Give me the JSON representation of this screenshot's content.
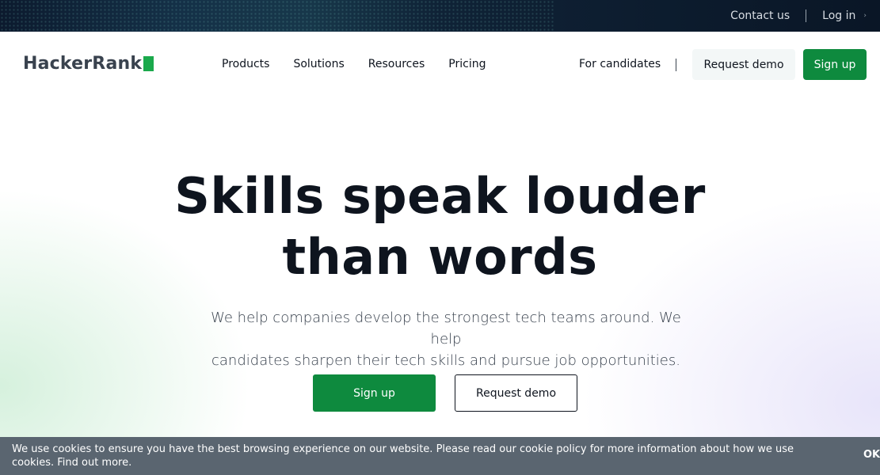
{
  "topbar": {
    "contact": "Contact us",
    "login": "Log in",
    "chevron": "›"
  },
  "header": {
    "logo_text": "HackerRank",
    "nav": [
      "Products",
      "Solutions",
      "Resources",
      "Pricing"
    ],
    "for_candidates": "For candidates",
    "request_demo": "Request demo",
    "sign_up": "Sign up"
  },
  "hero": {
    "title_line1": "Skills speak louder",
    "title_line2": "than words",
    "subtitle_line1": "We help companies develop the strongest tech teams around. We help",
    "subtitle_line2": "candidates sharpen their tech skills and pursue job opportunities.",
    "sign_up": "Sign up",
    "request_demo": "Request demo"
  },
  "cookie": {
    "text": "We use cookies to ensure you have the best browsing experience on our website. Please read our cookie policy for more information about how we use cookies. Find out more.",
    "ok": "OK"
  },
  "colors": {
    "brand_green": "#1ba94c",
    "button_green": "#0e8a3e",
    "dark_text": "#0e141e",
    "cookie_bg": "#5a6570"
  },
  "icons": {
    "logo_mark": "green-square",
    "login_chevron": "chevron-right-icon"
  }
}
